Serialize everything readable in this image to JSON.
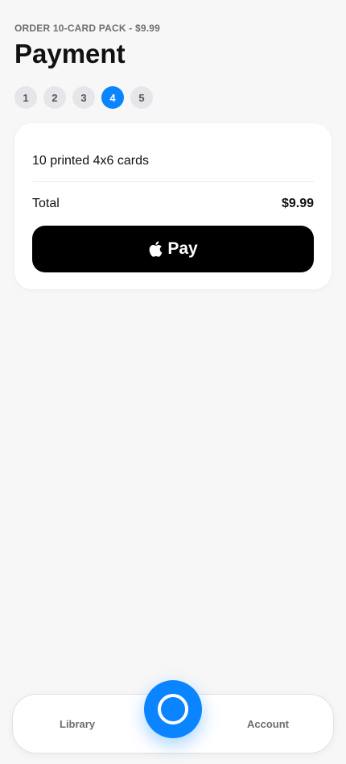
{
  "header": {
    "eyebrow": "ORDER 10-CARD PACK - $9.99",
    "title": "Payment"
  },
  "steps": [
    {
      "label": "1",
      "active": false
    },
    {
      "label": "2",
      "active": false
    },
    {
      "label": "3",
      "active": false
    },
    {
      "label": "4",
      "active": true
    },
    {
      "label": "5",
      "active": false
    }
  ],
  "order": {
    "item": "10 printed 4x6 cards",
    "total_label": "Total",
    "total_amount": "$9.99"
  },
  "pay_button": {
    "label": "Pay",
    "icon": "apple-icon"
  },
  "tabbar": {
    "library_label": "Library",
    "account_label": "Account",
    "center_icon": "camera-shutter-icon"
  },
  "colors": {
    "accent": "#0a84ff",
    "background": "#f7f7f7",
    "pay_button": "#000000"
  }
}
